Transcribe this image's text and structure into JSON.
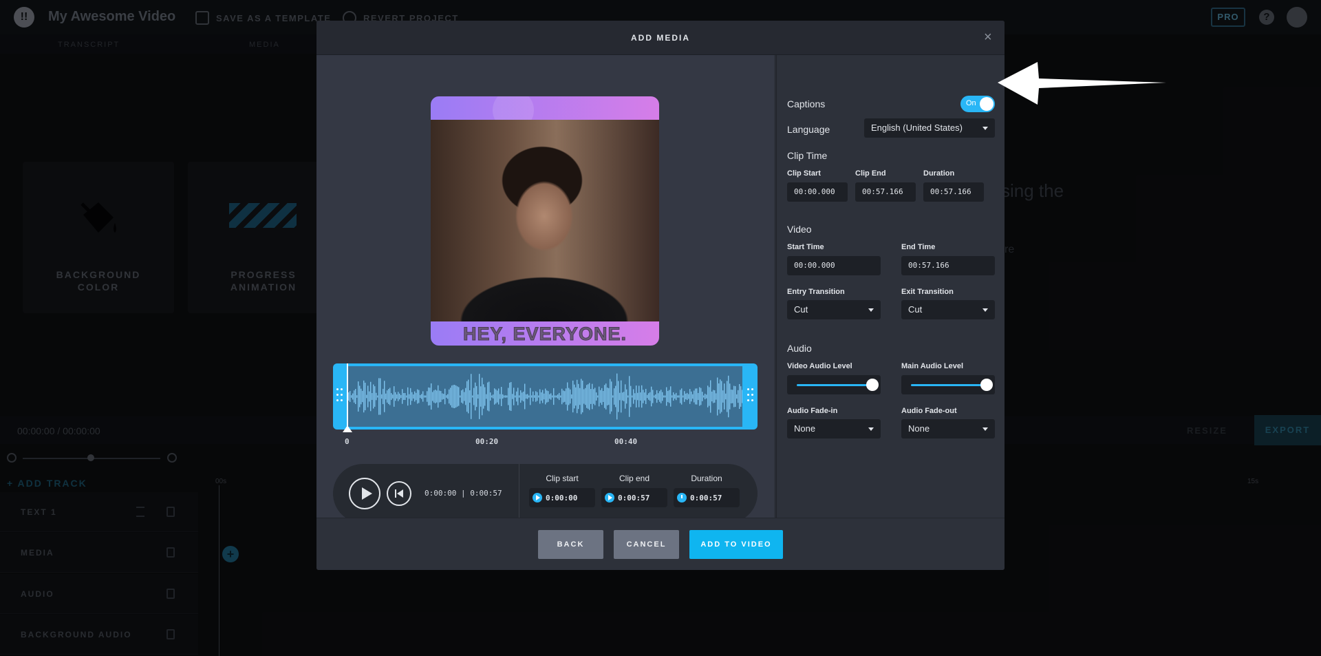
{
  "app": {
    "project_title": "My Awesome Video",
    "save_template": "SAVE AS A TEMPLATE",
    "revert_project": "REVERT PROJECT",
    "pro_badge": "PRO",
    "help": "?",
    "logo": "!!",
    "tabs": [
      "TRANSCRIPT",
      "MEDIA"
    ],
    "tiles": [
      {
        "line1": "BACKGROUND",
        "line2": "COLOR",
        "icon": "paint-bucket-icon"
      },
      {
        "line1": "PROGRESS",
        "line2": "ANIMATION",
        "icon": "progress-stripes-icon"
      }
    ],
    "bg_text_1": "sing the",
    "bg_text_2": "re",
    "time_readout": "00:00:00 / 00:00:00",
    "resize": "RESIZE",
    "export": "EXPORT",
    "add_track": "+ ADD TRACK",
    "timeline_start": "00s",
    "timeline_end": "15s",
    "tracks": [
      "TEXT 1",
      "MEDIA",
      "AUDIO",
      "BACKGROUND AUDIO"
    ],
    "add_clip_symbol": "+"
  },
  "modal": {
    "title": "ADD MEDIA",
    "close": "×",
    "preview_caption": "HEY, EVERYONE.",
    "waveform_ticks": [
      "0",
      "00:20",
      "00:40"
    ],
    "player": {
      "current_time": "0:00:00",
      "separator": "|",
      "total_time": "0:00:57",
      "clip_start_label": "Clip start",
      "clip_start": "0:00:00",
      "clip_end_label": "Clip end",
      "clip_end": "0:00:57",
      "duration_label": "Duration",
      "duration": "0:00:57"
    },
    "settings": {
      "captions_label": "Captions",
      "captions_state": "On",
      "language_label": "Language",
      "language_value": "English (United States)",
      "clip_time_title": "Clip Time",
      "clip_start_label": "Clip Start",
      "clip_start": "00:00.000",
      "clip_end_label": "Clip End",
      "clip_end": "00:57.166",
      "duration_label": "Duration",
      "duration": "00:57.166",
      "video_title": "Video",
      "start_time_label": "Start Time",
      "start_time": "00:00.000",
      "end_time_label": "End Time",
      "end_time": "00:57.166",
      "entry_transition_label": "Entry Transition",
      "entry_transition": "Cut",
      "exit_transition_label": "Exit Transition",
      "exit_transition": "Cut",
      "audio_title": "Audio",
      "video_audio_label": "Video Audio Level",
      "video_audio_level": 1.0,
      "main_audio_label": "Main Audio Level",
      "main_audio_level": 1.0,
      "fade_in_label": "Audio Fade-in",
      "fade_in": "None",
      "fade_out_label": "Audio Fade-out",
      "fade_out": "None"
    },
    "buttons": {
      "back": "BACK",
      "cancel": "CANCEL",
      "add": "ADD TO VIDEO"
    }
  },
  "colors": {
    "accent": "#29b6f6",
    "primary_button": "#0fb5f0",
    "modal_bg": "#2d313a"
  }
}
